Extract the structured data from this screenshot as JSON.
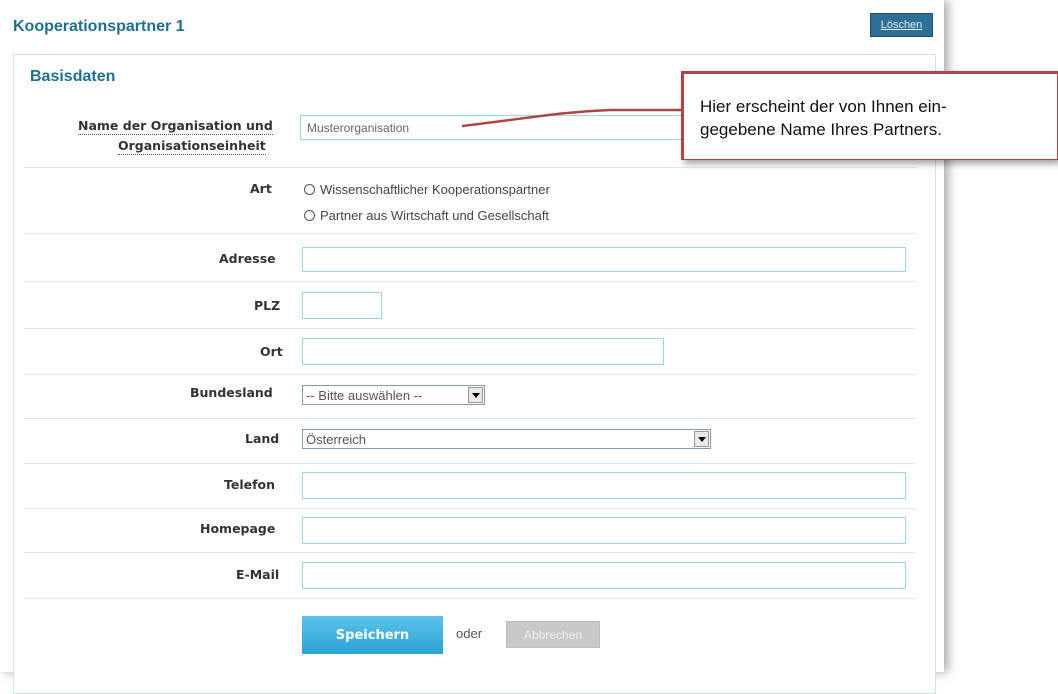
{
  "header": {
    "title": "Kooperationspartner 1",
    "delete_label": "Löschen"
  },
  "section": {
    "title": "Basisdaten"
  },
  "form": {
    "org_label_line1": "Name der Organisation und",
    "org_label_line2": "Organisationseinheit",
    "org_value": "Musterorganisation",
    "art_label": "Art",
    "art_options": [
      "Wissenschaftlicher Kooperationspartner",
      "Partner aus Wirtschaft und Gesellschaft"
    ],
    "address_label": "Adresse",
    "plz_label": "PLZ",
    "city_label": "Ort",
    "state_label": "Bundesland",
    "state_value": "-- Bitte auswählen --",
    "country_label": "Land",
    "country_value": "Österreich",
    "phone_label": "Telefon",
    "homepage_label": "Homepage",
    "email_label": "E-Mail"
  },
  "actions": {
    "save_label": "Speichern",
    "or_text": "oder",
    "cancel_label": "Abbrechen"
  },
  "callout": {
    "line1": "Hier erscheint der von Ihnen ein-",
    "line2": "gegebene Name Ihres Partners."
  },
  "colors": {
    "accent": "#1f6f8f",
    "callout_border": "#b04545",
    "save_button": "#2aa3d6",
    "input_border": "#9ed3e8"
  }
}
